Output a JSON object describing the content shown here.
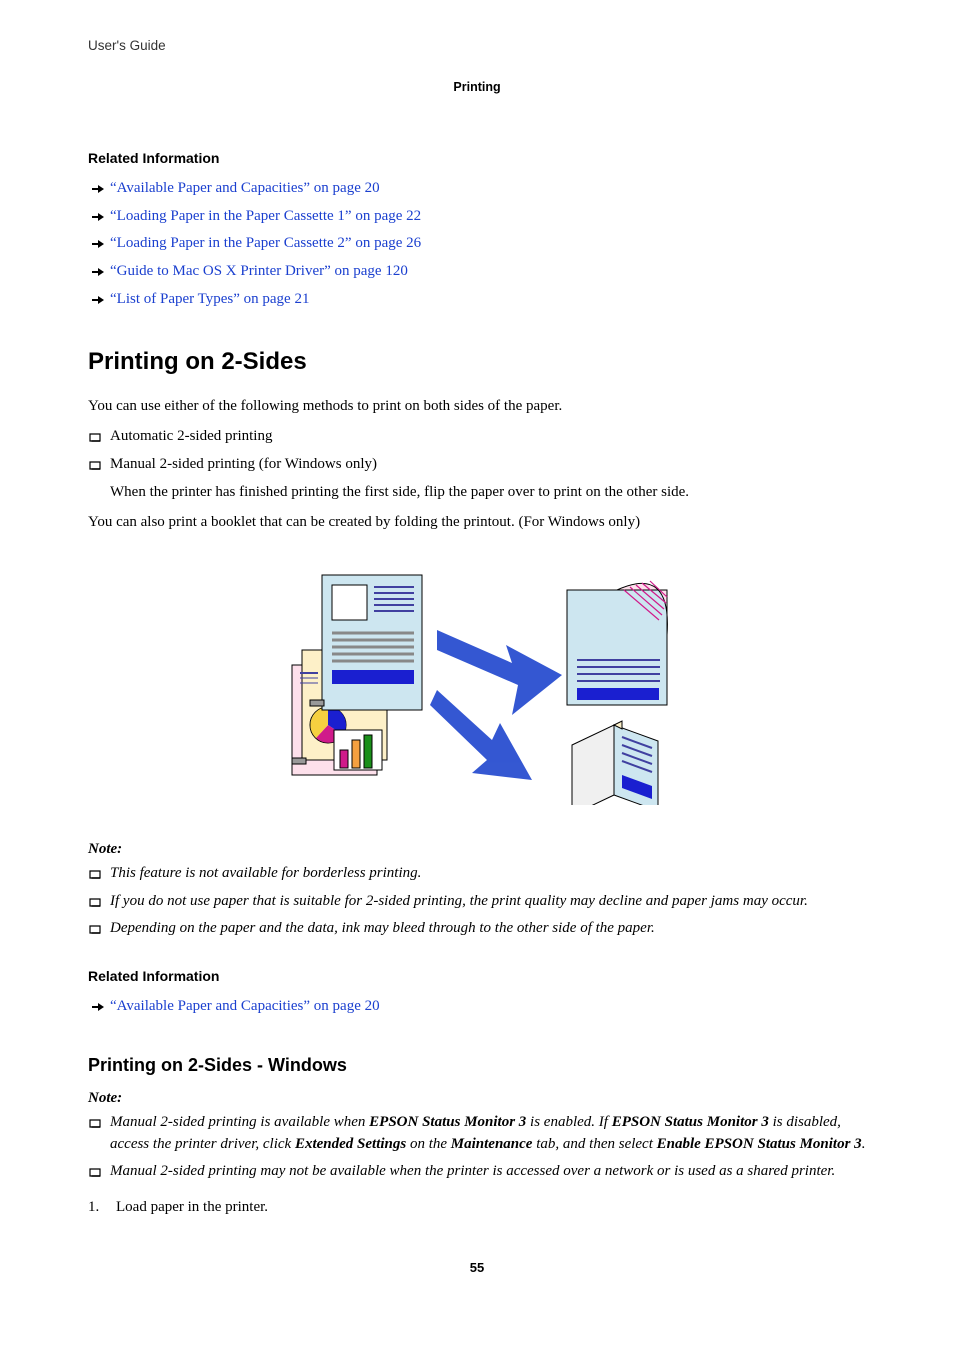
{
  "header": {
    "guide_title": "User's Guide",
    "chapter": "Printing"
  },
  "related1": {
    "heading": "Related Information",
    "links": [
      "“Available Paper and Capacities” on page 20",
      "“Loading Paper in the Paper Cassette 1” on page 22",
      "“Loading Paper in the Paper Cassette 2” on page 26",
      "“Guide to Mac OS X Printer Driver” on page 120",
      "“List of Paper Types” on page 21"
    ]
  },
  "sectionA": {
    "title": "Printing on 2-Sides",
    "intro": "You can use either of the following methods to print on both sides of the paper.",
    "items": [
      "Automatic 2-sided printing",
      "Manual 2-sided printing (for Windows only)"
    ],
    "subnote": "When the printer has finished printing the first side, flip the paper over to print on the other side.",
    "after": "You can also print a booklet that can be created by folding the printout. (For Windows only)"
  },
  "note1": {
    "label": "Note:",
    "items": [
      "This feature is not available for borderless printing.",
      "If you do not use paper that is suitable for 2-sided printing, the print quality may decline and paper jams may occur.",
      "Depending on the paper and the data, ink may bleed through to the other side of the paper."
    ]
  },
  "related2": {
    "heading": "Related Information",
    "links": [
      "“Available Paper and Capacities” on page 20"
    ]
  },
  "sectionB": {
    "title": "Printing on 2-Sides - Windows"
  },
  "note2": {
    "label": "Note:",
    "item1_parts": [
      "Manual 2-sided printing is available when ",
      "EPSON Status Monitor 3",
      " is enabled. If ",
      "EPSON Status Monitor 3",
      " is disabled, access the printer driver, click ",
      "Extended Settings",
      " on the ",
      "Maintenance",
      " tab, and then select ",
      "Enable EPSON Status Monitor 3",
      "."
    ],
    "item2": "Manual 2-sided printing may not be available when the printer is accessed over a network or is used as a shared printer."
  },
  "steps": {
    "n1": "1.",
    "t1": "Load paper in the printer."
  },
  "page_number": "55"
}
